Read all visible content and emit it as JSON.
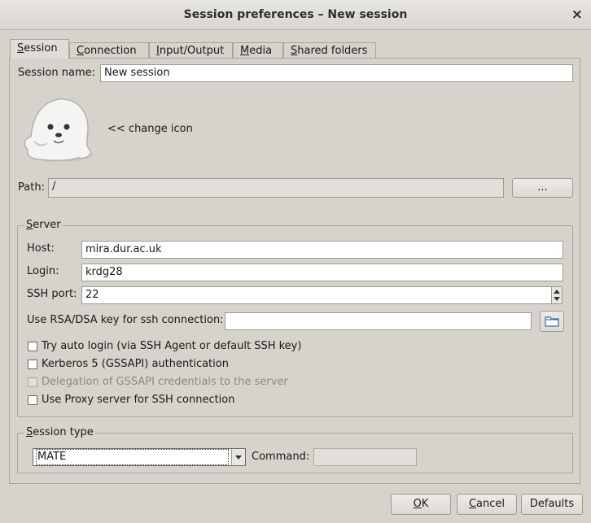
{
  "window": {
    "title": "Session preferences – New session",
    "close_glyph": "×"
  },
  "tabs": [
    {
      "label": "Session",
      "mnemonic": "S",
      "rest": "ession",
      "active": true
    },
    {
      "label": "Connection",
      "mnemonic": "C",
      "rest": "onnection"
    },
    {
      "label": "Input/Output",
      "mnemonic": "I",
      "rest": "nput/Output"
    },
    {
      "label": "Media",
      "mnemonic": "M",
      "rest": "edia"
    },
    {
      "label": "Shared folders",
      "mnemonic": "S",
      "rest": "hared folders"
    }
  ],
  "session": {
    "name_label": "Session name:",
    "name_value": "New session",
    "change_icon_label": "<< change icon",
    "path_label": "Path:",
    "path_value": "/",
    "browse_label": "..."
  },
  "server": {
    "group_title": "Server",
    "group_mnemonic": "S",
    "group_rest": "erver",
    "host_label": "Host:",
    "host_value": "mira.dur.ac.uk",
    "login_label": "Login:",
    "login_value": "krdg28",
    "port_label": "SSH port:",
    "port_value": "22",
    "key_label": "Use RSA/DSA key for ssh connection:",
    "key_value": "",
    "checkboxes": [
      {
        "label": "Try auto login (via SSH Agent or default SSH key)",
        "checked": false,
        "enabled": true
      },
      {
        "label": "Kerberos 5 (GSSAPI) authentication",
        "checked": false,
        "enabled": true
      },
      {
        "label": "Delegation of GSSAPI credentials to the server",
        "checked": false,
        "enabled": false
      },
      {
        "label": "Use Proxy server for SSH connection",
        "checked": false,
        "enabled": true
      }
    ]
  },
  "session_type": {
    "group_title": "Session type",
    "group_mnemonic": "S",
    "group_rest": "ession type",
    "selected": "MATE",
    "command_label": "Command:",
    "command_value": ""
  },
  "buttons": {
    "ok": {
      "label": "OK",
      "mnemonic": "O",
      "rest": "K"
    },
    "cancel": {
      "label": "Cancel",
      "mnemonic": "C",
      "rest": "ancel"
    },
    "defaults": {
      "label": "Defaults"
    }
  },
  "colors": {
    "window_bg": "#d6d2cc",
    "field_bg": "#ffffff",
    "border": "#a8a49e"
  }
}
